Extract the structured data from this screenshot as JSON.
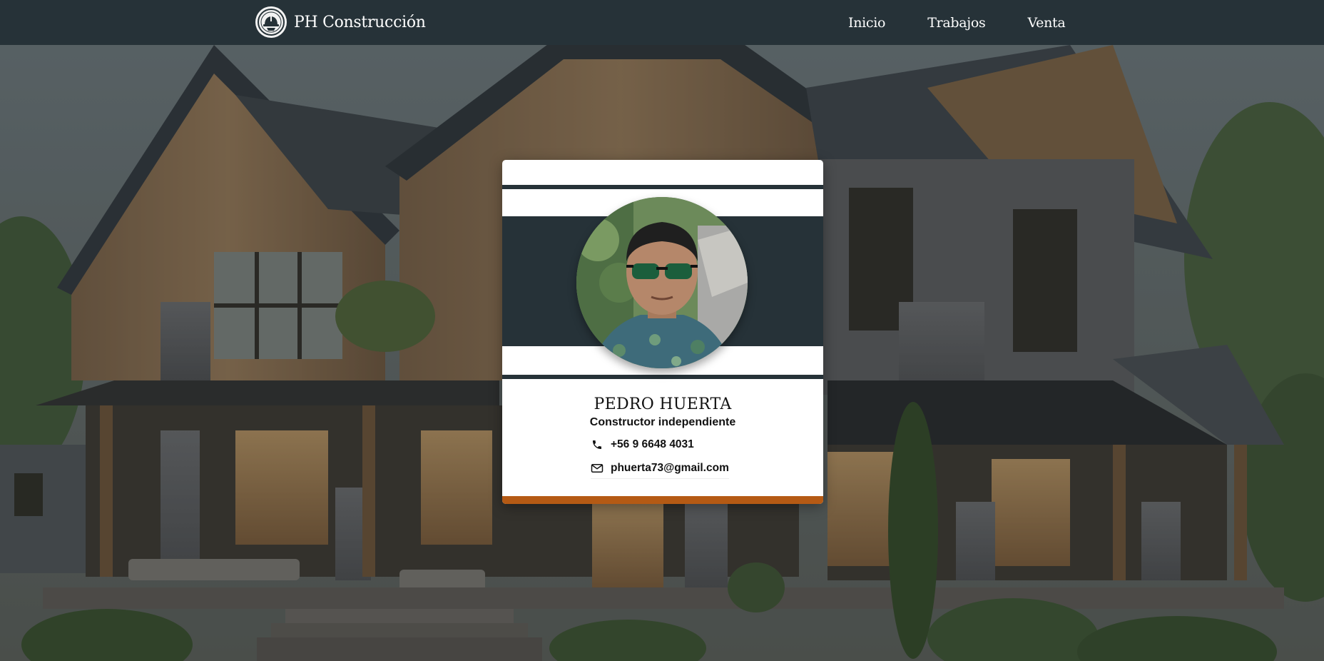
{
  "navbar": {
    "brand": "PH Construcción",
    "logo_icon": "helmet-logo-icon",
    "links": [
      {
        "label": "Inicio"
      },
      {
        "label": "Trabajos"
      },
      {
        "label": "Venta"
      }
    ],
    "background": "#263238"
  },
  "profile_card": {
    "name": "PEDRO HUERTA",
    "role": "Constructor independiente",
    "phone": "+56 9 6648 4031",
    "phone_icon": "phone-icon",
    "email": "phuerta73@gmail.com",
    "email_icon": "mail-icon",
    "accent_color": "#b55a14",
    "stripe_color": "#263238"
  }
}
